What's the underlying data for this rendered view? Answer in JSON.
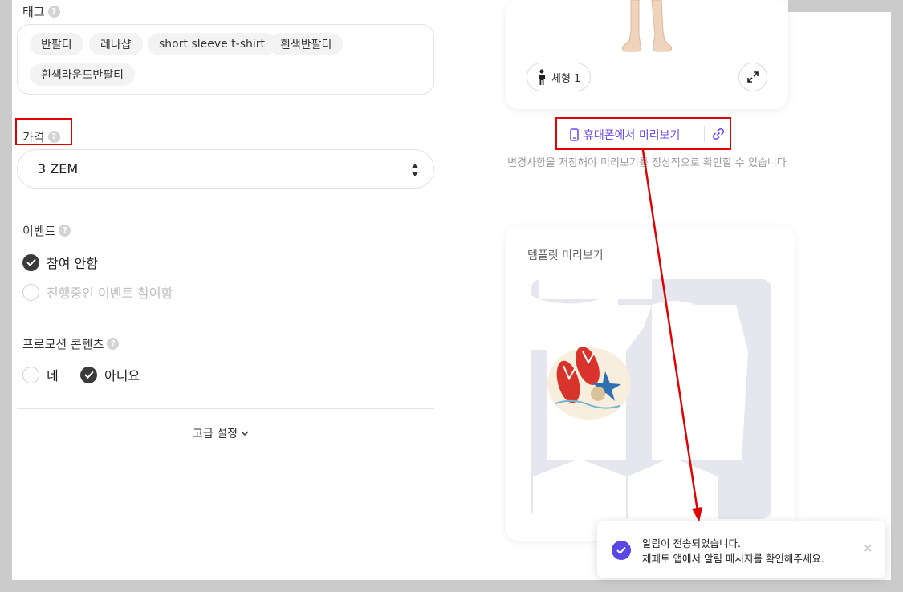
{
  "form": {
    "tags_label": "태그",
    "tags": [
      "반팔티",
      "레나샵",
      "short sleeve t-shirt",
      "흰색반팔티",
      "흰색라운드반팔티"
    ],
    "price_label": "가격",
    "price_value": "3 ZEM",
    "event_label": "이벤트",
    "event_options": [
      {
        "label": "참여 안함",
        "selected": true
      },
      {
        "label": "진행중인 이벤트 참여함",
        "selected": false
      }
    ],
    "promo_label": "프로모션 콘텐츠",
    "promo_options": [
      {
        "label": "네",
        "selected": false
      },
      {
        "label": "아니요",
        "selected": true
      }
    ],
    "advanced_label": "고급 설정"
  },
  "preview": {
    "body_type_label": "체형 1",
    "mobile_preview_label": "휴대폰에서 미리보기",
    "note": "변경사항을 저장해야 미리보기를 정상적으로 확인할 수 있습니다",
    "template_title": "템플릿 미리보기"
  },
  "toast": {
    "line1": "알림이 전송되었습니다.",
    "line2": "제페토 앱에서 알림 메시지를 확인해주세요.",
    "close": "×"
  },
  "colors": {
    "accent": "#6c4cf5",
    "toast_check": "#5a47e6",
    "annotation_red": "#e30000",
    "template_bg": "#e6e6ee"
  }
}
